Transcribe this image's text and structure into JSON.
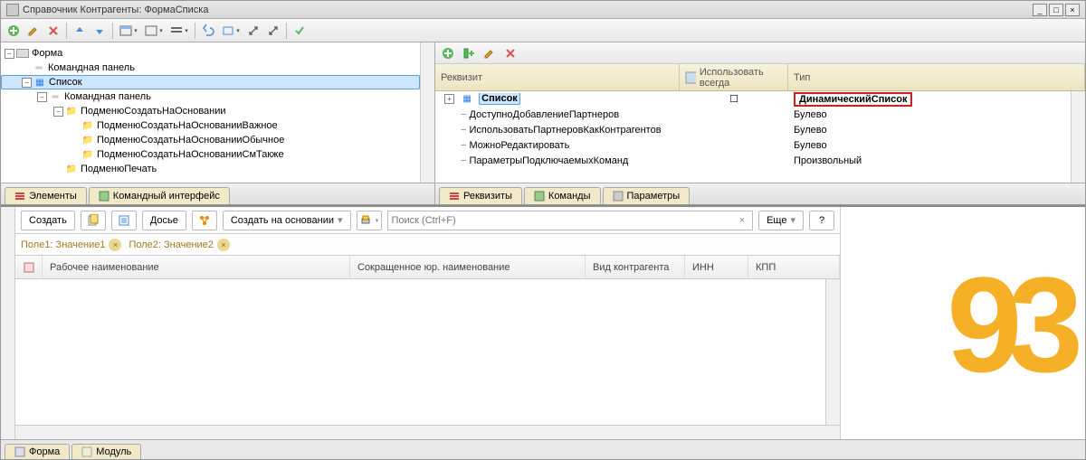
{
  "window": {
    "title": "Справочник Контрагенты: ФормаСписка"
  },
  "tree": {
    "items": [
      {
        "label": "Форма",
        "indent": 0,
        "icon": "form",
        "toggle": "-"
      },
      {
        "label": "Командная панель",
        "indent": 1,
        "icon": "cmd",
        "toggle": ""
      },
      {
        "label": "Список",
        "indent": 1,
        "icon": "list",
        "toggle": "-",
        "selected": true
      },
      {
        "label": "Командная панель",
        "indent": 2,
        "icon": "cmd",
        "toggle": "-"
      },
      {
        "label": "ПодменюСоздатьНаОсновании",
        "indent": 3,
        "icon": "folder",
        "toggle": "-"
      },
      {
        "label": "ПодменюСоздатьНаОснованииВажное",
        "indent": 4,
        "icon": "folder",
        "toggle": ""
      },
      {
        "label": "ПодменюСоздатьНаОснованииОбычное",
        "indent": 4,
        "icon": "folder",
        "toggle": ""
      },
      {
        "label": "ПодменюСоздатьНаОснованииСмТакже",
        "indent": 4,
        "icon": "folder",
        "toggle": ""
      },
      {
        "label": "ПодменюПечать",
        "indent": 3,
        "icon": "folder",
        "toggle": ""
      }
    ]
  },
  "left_tabs": {
    "tab1": "Элементы",
    "tab2": "Командный интерфейс"
  },
  "right_header": {
    "col1": "Реквизит",
    "col2": "Использовать всегда",
    "col3": "Тип"
  },
  "right_rows": [
    {
      "name": "Список",
      "use": "",
      "type": "ДинамическийСписок",
      "selected": true,
      "highlight": true,
      "toggle": "+"
    },
    {
      "name": "ДоступноДобавлениеПартнеров",
      "use": "",
      "type": "Булево"
    },
    {
      "name": "ИспользоватьПартнеровКакКонтрагентов",
      "use": "",
      "type": "Булево"
    },
    {
      "name": "МожноРедактировать",
      "use": "",
      "type": "Булево"
    },
    {
      "name": "ПараметрыПодключаемыхКоманд",
      "use": "",
      "type": "Произвольный"
    }
  ],
  "right_tabs": {
    "tab1": "Реквизиты",
    "tab2": "Команды",
    "tab3": "Параметры"
  },
  "preview": {
    "create": "Создать",
    "dossier": "Досье",
    "create_based": "Создать на основании",
    "search_placeholder": "Поиск (Ctrl+F)",
    "more": "Еще",
    "help": "?",
    "filter1": "Поле1: Значение1",
    "filter2": "Поле2: Значение2",
    "columns": {
      "c1": "Рабочее наименование",
      "c2": "Сокращенное юр. наименование",
      "c3": "Вид контрагента",
      "c4": "ИНН",
      "c5": "КПП"
    }
  },
  "bottom_tabs": {
    "t1": "Форма",
    "t2": "Модуль"
  },
  "logo": "93"
}
